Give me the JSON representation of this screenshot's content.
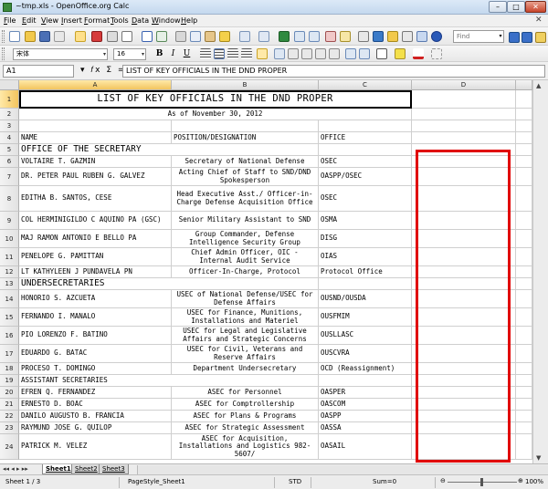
{
  "window": {
    "title": "~tmp.xls - OpenOffice.org Calc",
    "minimize": "–",
    "maximize": "□",
    "close": "✕"
  },
  "menu": [
    "File",
    "Edit",
    "View",
    "Insert",
    "Format",
    "Tools",
    "Data",
    "Window",
    "Help"
  ],
  "menu_close": "✕",
  "toolbar": {
    "find_placeholder": "Find",
    "font_name": "宋体",
    "font_size": "16",
    "bold": "B",
    "italic": "I",
    "underline": "U"
  },
  "formula_bar": {
    "name_box": "A1",
    "function_icons": "▾ 𝑓x Σ =",
    "content": "LIST OF KEY OFFICIALS IN THE DND PROPER"
  },
  "sheet": {
    "columns": [
      "A",
      "B",
      "C",
      "D"
    ],
    "rows": [
      {
        "n": "1",
        "a": "LIST OF KEY OFFICIALS IN THE DND PROPER",
        "b": "",
        "c": "",
        "merge": "title"
      },
      {
        "n": "2",
        "a": "As of November 30, 2012",
        "b": "",
        "c": "",
        "merge": "center"
      },
      {
        "n": "3",
        "a": "",
        "b": "",
        "c": ""
      },
      {
        "n": "4",
        "a": "NAME",
        "b": "POSITION/DESIGNATION",
        "c": "OFFICE"
      },
      {
        "n": "5",
        "a": "OFFICE OF THE SECRETARY",
        "b": "",
        "c": "",
        "merge": "section"
      },
      {
        "n": "6",
        "a": "VOLTAIRE T. GAZMIN",
        "b": "Secretary of National Defense",
        "c": "OSEC"
      },
      {
        "n": "7",
        "a": "DR. PETER PAUL RUBEN G. GALVEZ",
        "b": "Acting Chief of Staff to SND/DND Spokesperson",
        "c": "OASPP/OSEC"
      },
      {
        "n": "8",
        "a": "EDITHA B. SANTOS, CESE",
        "b": "Head Executive Asst./ Officer-in-Charge Defense Acquisition Office",
        "c": "OSEC"
      },
      {
        "n": "9",
        "a": "COL HERMINIGILDO C AQUINO PA (GSC)",
        "b": "Senior Military Assistant to SND",
        "c": "OSMA"
      },
      {
        "n": "10",
        "a": "MAJ RAMON ANTONIO E BELLO PA",
        "b": "Group Commander, Defense Intelligence Security Group",
        "c": "DISG"
      },
      {
        "n": "11",
        "a": "PENELOPE G. PAMITTAN",
        "b": "Chief Admin Officer, OIC - Internal Audit Service",
        "c": "OIAS"
      },
      {
        "n": "12",
        "a": "LT KATHYLEEN J PUNDAVELA PN",
        "b": "Officer-In-Charge, Protocol",
        "c": "Protocol Office"
      },
      {
        "n": "13",
        "a": "UNDERSECRETARIES",
        "b": "",
        "c": "",
        "merge": "section"
      },
      {
        "n": "14",
        "a": "HONORIO S. AZCUETA",
        "b": "USEC of National Defense/USEC for Defense Affairs",
        "c": "OUSND/OUSDA"
      },
      {
        "n": "15",
        "a": "FERNANDO I. MANALO",
        "b": "USEC for Finance, Munitions, Installations and Materiel",
        "c": "OUSFMIM"
      },
      {
        "n": "16",
        "a": "PIO LORENZO F. BATINO",
        "b": "USEC for Legal and Legislative Affairs and Strategic Concerns",
        "c": "OUSLLASC"
      },
      {
        "n": "17",
        "a": "EDUARDO G. BATAC",
        "b": "USEC for Civil, Veterans and Reserve Affairs",
        "c": "OUSCVRA"
      },
      {
        "n": "18",
        "a": "PROCESO T. DOMINGO",
        "b": "Department Undersecretary",
        "c": "OCD (Reassignment)"
      },
      {
        "n": "19",
        "a": "ASSISTANT SECRETARIES",
        "b": "",
        "c": "",
        "merge": "section-small"
      },
      {
        "n": "20",
        "a": "EFREN Q. FERNANDEZ",
        "b": "ASEC for Personnel",
        "c": "OASPER"
      },
      {
        "n": "21",
        "a": "ERNESTO D. BOAC",
        "b": "ASEC for Comptrollership",
        "c": "OASCOM"
      },
      {
        "n": "22",
        "a": "DANILO AUGUSTO B. FRANCIA",
        "b": "ASEC for Plans & Programs",
        "c": "OASPP"
      },
      {
        "n": "23",
        "a": "RAYMUND JOSE G. QUILOP",
        "b": "ASEC for Strategic Assessment",
        "c": "OASSA"
      },
      {
        "n": "24",
        "a": "PATRICK M. VELEZ",
        "b": "ASEC for Acquisition, Installations and Logistics 982-5607/",
        "c": "OASAIL"
      }
    ]
  },
  "tabs": {
    "nav": "◂◂ ◂ ▸ ▸▸",
    "sheets": [
      "Sheet1",
      "Sheet2",
      "Sheet3"
    ],
    "active": "Sheet1"
  },
  "status": {
    "sheet": "Sheet 1 / 3",
    "page_style": "PageStyle_Sheet1",
    "mode": "STD",
    "sum": "Sum=0",
    "zoom": "100%"
  }
}
